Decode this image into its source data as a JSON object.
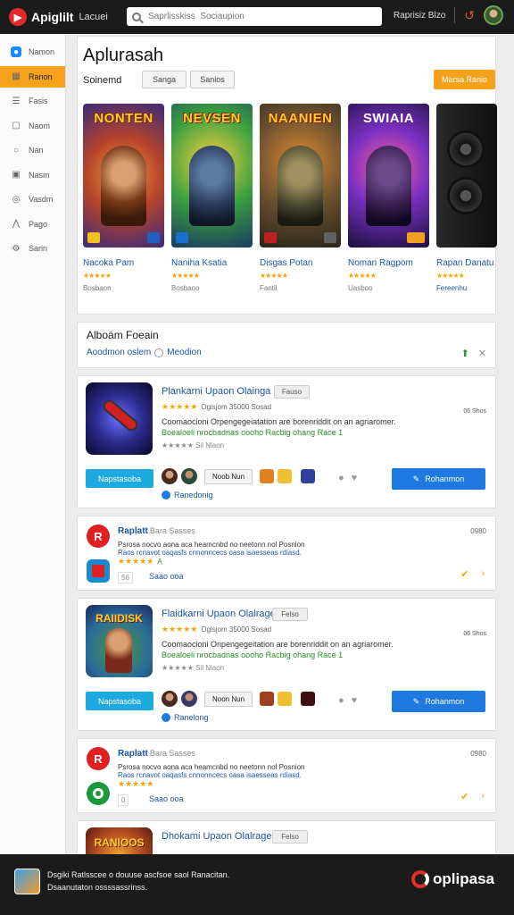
{
  "topbar": {
    "brand": "Apiglilt",
    "brand_sub": "Lacuei",
    "search_placeholder": "Saprlisskiss  Sociaupion",
    "user_label": "Raprisiz Blzo"
  },
  "sidebar": {
    "items": [
      {
        "label": "Namon",
        "icon": "app-icon"
      },
      {
        "label": "Ranon",
        "icon": "grid-icon"
      },
      {
        "label": "Fasis",
        "icon": "list-icon"
      },
      {
        "label": "Naom",
        "icon": "message-icon"
      },
      {
        "label": "Nan",
        "icon": "search-icon"
      },
      {
        "label": "Nasm",
        "icon": "window-icon"
      },
      {
        "label": "Vasdm",
        "icon": "globe-icon"
      },
      {
        "label": "Pago",
        "icon": "chart-icon"
      },
      {
        "label": "Sarin",
        "icon": "gear-icon"
      }
    ]
  },
  "hero": {
    "title": "Aplurasah",
    "label": "Soinemd",
    "pill1": "Sanga",
    "pill2": "Sanios",
    "cta": "Marsa Ranio"
  },
  "games": [
    {
      "art_title": "NONTEN",
      "name": "Nacoka Pam",
      "meta": "Bosbaon",
      "stars": "★★★★★"
    },
    {
      "art_title": "NEVSEN",
      "name": "Naniha Ksatia",
      "meta": "Bosbaoo",
      "stars": "★★★★★"
    },
    {
      "art_title": "NAANIEN",
      "name": "Disgas Potan",
      "meta": "Fantil",
      "stars": "★★★★★"
    },
    {
      "art_title": "SWIAIA",
      "name": "Noman Ragpom",
      "meta": "Uasboo",
      "stars": "★★★★★"
    },
    {
      "art_title": "",
      "name": "Rapan Danatu",
      "meta": "Fereenhu",
      "stars": "★★★★★"
    }
  ],
  "section": {
    "title": "Alboám Foeain",
    "link1": "Aoodmon oslem",
    "link2": "Meodion"
  },
  "app1": {
    "title": "Plankarni Upaon Olainga",
    "tag": "Fauso",
    "stars": "★★★★★",
    "rating_text": "Ogisjom 35000   Sosad",
    "desc1": "Coomaocioni Orpengegeiatation are borenriddit on an agriaromer.",
    "desc2": "Boealoeli nrocbadnas oooho Racbig ohang Race 1",
    "meta": "★★★★★  Sil Nlaon",
    "date": "06 Shos",
    "left_btn": "Napstasoba",
    "pill": "Noob Nun",
    "right_btn": "Rohanmon",
    "sub_link": "Ranedonig"
  },
  "app2": {
    "title": "Raplatt",
    "title_sub": "Bara Sasses",
    "desc1": "Psrosa nocvo aona aca heamcnbd no neetonn nol Posnion",
    "desc2": "Raos rcnavot oaqasfs cnnonncecs oasa isaesseas rdiasd.",
    "stars": "★★★★★",
    "stars_note": "A",
    "count": "56",
    "price": "Saao ooa",
    "right": "0980"
  },
  "app3": {
    "art_title": "RAIIDISK",
    "title": "Flaidkarni Upaon Olalrage",
    "tag": "Felso",
    "stars": "★★★★★",
    "rating_text": "Ogisjom 35000   Sosad",
    "desc1": "Coomaocioni Oripengegeitation are borenriddit on an agriaromer.",
    "desc2": "Boealoeli nrocbadnas oooho Racbig ohang Race 1",
    "meta": "★★★★★  Sil Nlaon",
    "date": "06 Shos",
    "left_btn": "Napstasoba",
    "pill": "Noon Nun",
    "right_btn": "Rohanmon",
    "sub_link": "Ranelong"
  },
  "app4": {
    "title": "Raplatt",
    "title_sub": "Bara Sasses",
    "desc1": "Psrosa nocvo aona aca heamcnbd no neetonn nol Posnion",
    "desc2": "Raos rcnavot oaqasfs cnnonncecs oasa isaesseas rdiasd.",
    "stars": "★★★★★",
    "stars_note": "",
    "count": "0",
    "price": "Saao ooa",
    "right": "0980"
  },
  "app5": {
    "art_title": "RANIOOS",
    "title": "Dhokami Upaon Olalrage",
    "tag": "Felso"
  },
  "footer": {
    "line1": "Dsgiki Ratlsscee o douuse ascfsoe saol Ranacitan.",
    "line2": "Dsaanutaton ossssassrinss.",
    "brand": "oplipasa"
  },
  "colors": {
    "accent_orange": "#f5a11c",
    "primary_blue": "#1e7ae0",
    "cyan": "#1eaae0",
    "brand_red": "#e32b2b"
  }
}
